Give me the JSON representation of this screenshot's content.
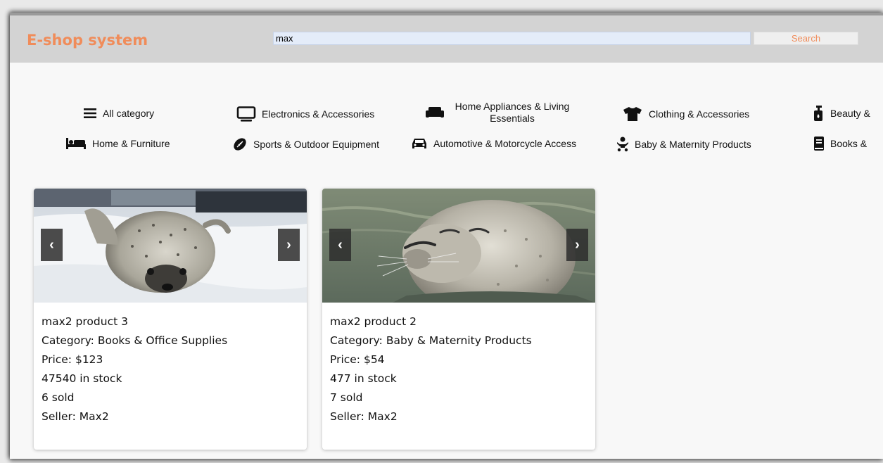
{
  "header": {
    "brand": "E-shop system",
    "search_value": "max",
    "search_button": "Search",
    "brand_color": "#f08c5a"
  },
  "categories": [
    {
      "label": "All category",
      "icon": "bars-icon"
    },
    {
      "label": "Electronics & Accessories",
      "icon": "monitor-icon"
    },
    {
      "label": "Home Appliances & Living Essentials",
      "icon": "couch-icon"
    },
    {
      "label": "Clothing & Accessories",
      "icon": "tshirt-icon"
    },
    {
      "label": "Beauty &",
      "icon": "pump-bottle-icon"
    },
    {
      "label": "Home & Furniture",
      "icon": "bed-icon"
    },
    {
      "label": "Sports & Outdoor Equipment",
      "icon": "football-icon"
    },
    {
      "label": "Automotive & Motorcycle Access",
      "icon": "car-icon"
    },
    {
      "label": "Baby & Maternity Products",
      "icon": "baby-icon"
    },
    {
      "label": "Books &",
      "icon": "book-icon"
    }
  ],
  "products": [
    {
      "name": "max2 product 3",
      "category": "Category: Books & Office Supplies",
      "price": "Price: $123",
      "stock": "47540 in stock",
      "sold": "6 sold",
      "seller": "Seller: Max2",
      "image": "seal-on-snow"
    },
    {
      "name": "max2 product 2",
      "category": "Category: Baby & Maternity Products",
      "price": "Price: $54",
      "stock": "477 in stock",
      "sold": "7 sold",
      "seller": "Seller: Max2",
      "image": "seal-in-water"
    }
  ],
  "carousel": {
    "prev": "‹",
    "next": "›"
  }
}
